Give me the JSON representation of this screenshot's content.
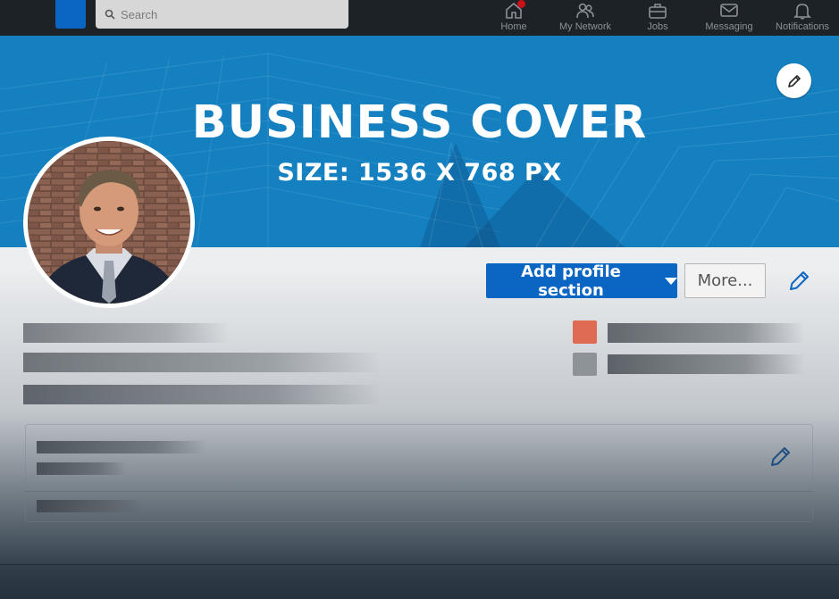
{
  "nav": {
    "search_placeholder": "Search",
    "items": [
      {
        "label": "Home",
        "icon": "home-icon",
        "has_badge": true
      },
      {
        "label": "My Network",
        "icon": "network-icon"
      },
      {
        "label": "Jobs",
        "icon": "briefcase-icon"
      },
      {
        "label": "Messaging",
        "icon": "messaging-icon"
      },
      {
        "label": "Notifications",
        "icon": "bell-icon"
      }
    ]
  },
  "cover": {
    "title": "BUSINESS COVER",
    "subtitle": "SIZE: 1536 X 768 PX"
  },
  "actions": {
    "add_section_label": "Add profile section",
    "more_label": "More..."
  },
  "colors": {
    "brand": "#0a66c2",
    "cover": "#1480c0",
    "nav_bg": "#1d2226",
    "badge": "#cc1016",
    "placeholder_orange": "#e06b54",
    "placeholder_gray": "#8e9398"
  }
}
